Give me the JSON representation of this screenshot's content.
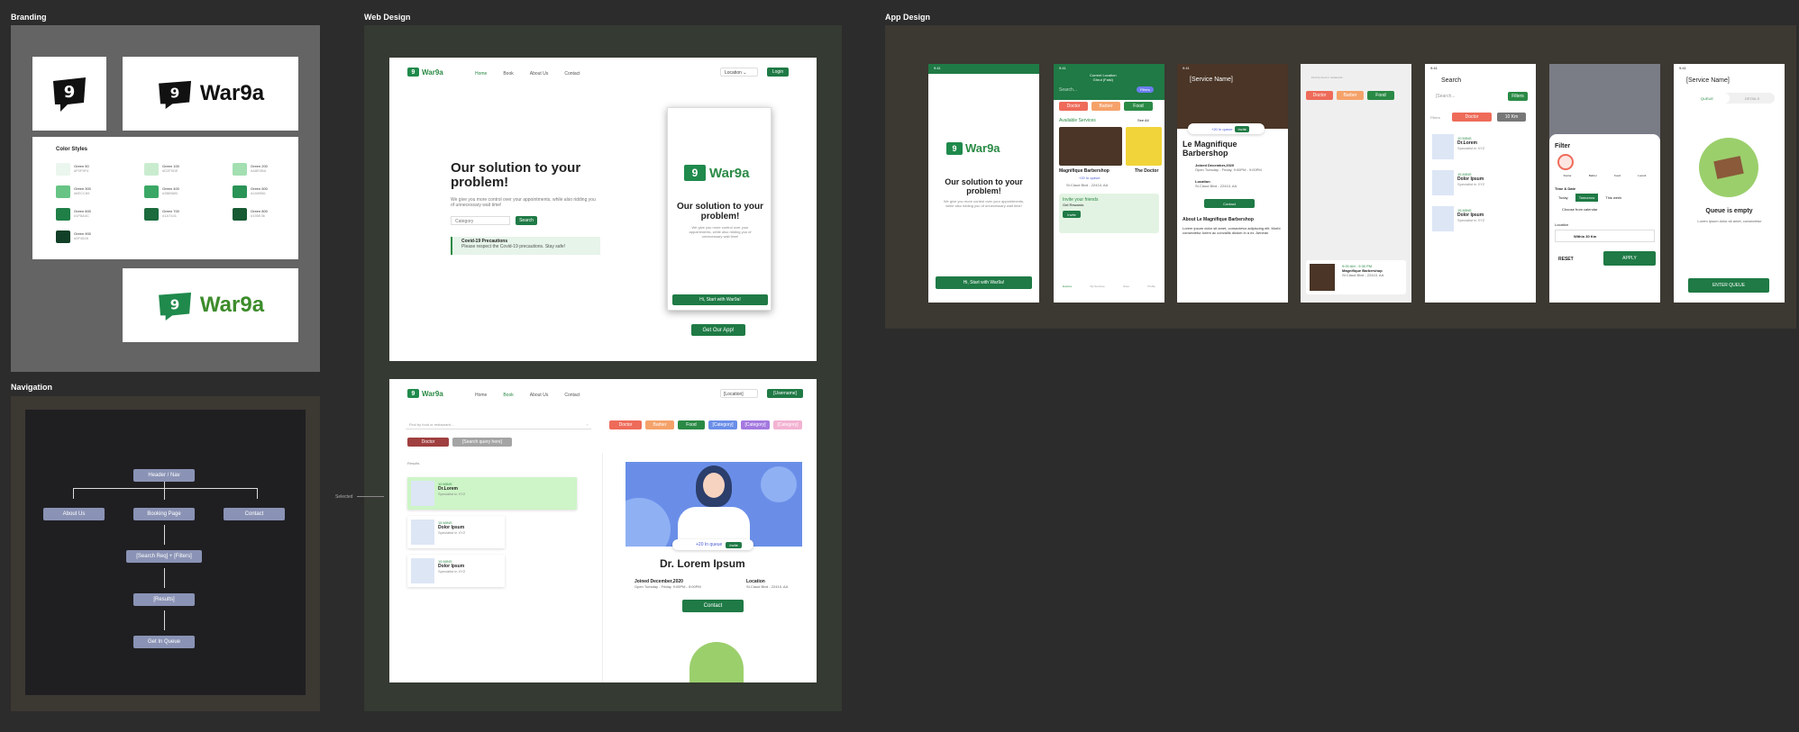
{
  "sections": {
    "branding": "Branding",
    "navigation": "Navigation",
    "web_design": "Web Design",
    "app_design": "App Design"
  },
  "brand": {
    "name": "War9a",
    "glyph": "9"
  },
  "colors": {
    "title": "Color Styles",
    "swatches": [
      {
        "name": "Green 50",
        "hex": "#F0F9F4",
        "color": "#eaf6ee"
      },
      {
        "name": "Green 100",
        "hex": "#D2F0DE",
        "color": "#c9eccf"
      },
      {
        "name": "Green 200",
        "hex": "#A8E0BA",
        "color": "#a3dfb1"
      },
      {
        "name": "Green 300",
        "hex": "#6ECC89",
        "color": "#67c484"
      },
      {
        "name": "Green 400",
        "hex": "#3BB56B",
        "color": "#3aa864"
      },
      {
        "name": "Green 500",
        "hex": "#2A9B56",
        "color": "#2a9356"
      },
      {
        "name": "Green 600",
        "hex": "#1F8A4C",
        "color": "#1f7f47"
      },
      {
        "name": "Green 700",
        "hex": "#1A7441",
        "color": "#1b6b3d"
      },
      {
        "name": "Green 800",
        "hex": "#155E36",
        "color": "#175a34"
      },
      {
        "name": "Green 900",
        "hex": "#0F4528",
        "color": "#113f27"
      }
    ]
  },
  "nav": {
    "header": "Header / Nav",
    "about": "About Us",
    "booking": "Booking Page",
    "contact": "Contact",
    "search": "[Search Req] + [Filters]",
    "results": "[Results]",
    "queue": "Get In Queue"
  },
  "web1": {
    "menu": [
      "Home",
      "Book",
      "About Us",
      "Contact"
    ],
    "location": "Location",
    "login": "Login",
    "headline": "Our solution to your problem!",
    "sub": "We give you more control over your appointments, while also ridding you of unnecessary wait time!",
    "category": "Category",
    "search": "Search",
    "covid_title": "Covid-19 Precautions",
    "covid_text": "Please respect the Covid-19 precautions. Stay safe!",
    "phone_headline": "Our solution to your problem!",
    "phone_sub": "We give you more control over your appointments, while also ridding you of unnecessary wait time!",
    "start": "Hi, Start with War9a!",
    "get_app": "Get Our App!"
  },
  "web2": {
    "menu": [
      "Home",
      "Book",
      "About Us",
      "Contact"
    ],
    "location": "[Location]",
    "username": "[Username]",
    "search_ph": "Find by food or restaurant...",
    "chips": [
      "Doctor",
      "Barber",
      "Food",
      "[Category]",
      "[Category]",
      "[Category]"
    ],
    "filter_a": "Doctor",
    "filter_b": "[Search query here]",
    "results_label": "Results",
    "selected": "Selected",
    "results": [
      {
        "time": "10 MINS",
        "name": "Dr.Lorem",
        "spec": "Specialist in XYZ"
      },
      {
        "time": "15 MINS",
        "name": "Dolor Ipsum",
        "spec": "Specialist in XYZ"
      },
      {
        "time": "15 MINS",
        "name": "Dolor Ipsum",
        "spec": "Specialist in XYZ"
      }
    ],
    "queue": "+20 In queue",
    "invite": "Invite",
    "doctor_name": "Dr. Lorem Ipsum",
    "joined": "Joined December,2020",
    "hours": "Open Tuesday - Friday, 9:00PM - 9:00PM",
    "loc_label": "Location",
    "loc_val": "St.Claud Blvd - 22410, AA",
    "contact": "Contact"
  },
  "app": {
    "time": "9:41",
    "s1": {
      "headline": "Our solution to your problem!",
      "sub": "We give you more control over your appointments, while also ridding you of unnecessary wait time!",
      "start": "Hi, Start with War9a!"
    },
    "s2": {
      "loc": "Current Location",
      "loc_val": "Ghrut (Faisl)",
      "search": "Search...",
      "filters": "Filters",
      "chips": [
        "Doctor",
        "Barber",
        "Food"
      ],
      "available": "Available Services",
      "see_all": "See All",
      "card1": "Magnifique Barbershop",
      "card2": "The Doctor",
      "queue": "+20 In queue",
      "addr": "St.Claud Blvd - 22410, AA",
      "invite": "Invite your friends",
      "rewards": "Get Rewards",
      "invite_btn": "Invite",
      "tabs": [
        "Explore",
        "My Services",
        "Store",
        "Profile"
      ]
    },
    "s3": {
      "title": "[Service Name]",
      "queue": "+20 In queue",
      "invite": "Invite",
      "name": "Le Magnifique Barbershop",
      "joined": "Joined December,2020",
      "hours": "Open Tuesday - Friday, 9:00PM - 9:00PM",
      "loc": "Location",
      "loc_val": "St.Claud Blvd - 22410, AA",
      "contact": "Contact",
      "about": "About Le Magnifique Barbershop",
      "desc": "Lorem ipsum dolor sit amet, consectetur adipiscing elit. Morbi consectetur lorem ac convallis dictum in a ex. Aenean"
    },
    "s4": {
      "search": "Find by food or restaurant...",
      "chips": [
        "Doctor",
        "Barber",
        "Food"
      ],
      "hours": "9:00 AM - 9:30 PM",
      "name": "Magnifique Barbershop",
      "addr": "St.Claud Blvd - 22410, AA"
    },
    "s5": {
      "title": "Search",
      "search": "[Search...",
      "filters_btn": "Filters",
      "filters": "Filters",
      "f1": "Doctor",
      "f2": "10 Km",
      "results": [
        {
          "time": "10 MINS",
          "name": "Dr.Lorem",
          "spec": "Specialist in XYZ"
        },
        {
          "time": "15 MINS",
          "name": "Dolor Ipsum",
          "spec": "Specialist in XYZ"
        },
        {
          "time": "15 MINS",
          "name": "Dolor Ipsum",
          "spec": "Specialist in XYZ"
        }
      ]
    },
    "s6": {
      "title": "Filter",
      "cats": [
        "Doctor",
        "Barber",
        "Food",
        "Loomit"
      ],
      "time_label": "Time & Date",
      "times": [
        "Today",
        "Tomorrow",
        "This week"
      ],
      "calendar": "Choose from calendar",
      "location_label": "Location",
      "within": "Within 30 Km",
      "reset": "RESET",
      "apply": "APPLY"
    },
    "s7": {
      "title": "[Service Name]",
      "tab1": "QUEUE",
      "tab2": "DETAILS",
      "empty": "Queue is empty",
      "empty_sub": "Lorem ipsum dolor sit amet, consectetur",
      "enter": "ENTER QUEUE"
    }
  }
}
